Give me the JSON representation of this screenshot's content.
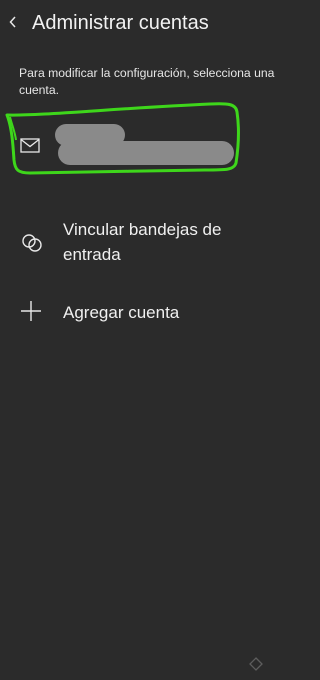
{
  "header": {
    "title": "Administrar cuentas",
    "back_icon": "chevron-left-icon"
  },
  "hint_text": "Para modificar la configuración, selecciona una cuenta.",
  "account": {
    "icon": "mail-icon",
    "name_redacted": true,
    "highlight_color": "#3ed61b"
  },
  "menu": {
    "link_inboxes": {
      "label": "Vincular bandejas de entrada",
      "icon": "link-icon"
    },
    "add_account": {
      "label": "Agregar cuenta",
      "icon": "plus-icon"
    }
  },
  "colors": {
    "background": "#2b2b2b",
    "text": "#f0f0f0",
    "redaction": "#8a8a8a"
  }
}
